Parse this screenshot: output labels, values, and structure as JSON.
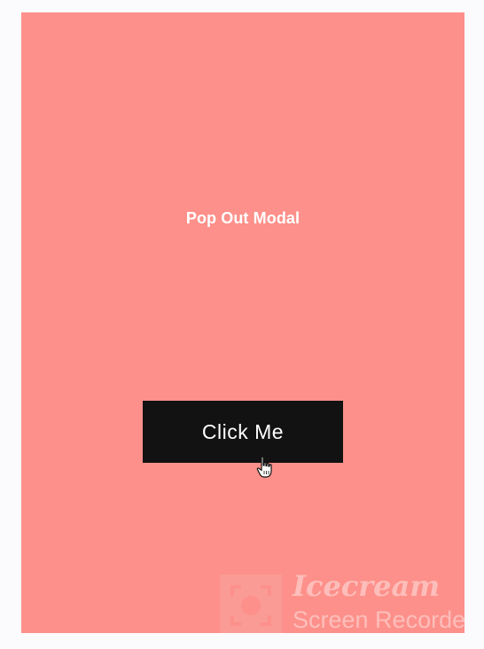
{
  "modal_demo": {
    "title": "Pop Out Modal",
    "button_label": "Click Me"
  },
  "watermark": {
    "brand": "Icecream",
    "subtitle": "Screen Recorder"
  },
  "colors": {
    "page_background": "#fbfbfe",
    "panel_background": "#fd908a",
    "button_background": "#121212",
    "text_light": "#ffffff"
  },
  "icons": {
    "cursor": "hand-pointer-icon",
    "watermark_logo": "camera-target-icon"
  }
}
